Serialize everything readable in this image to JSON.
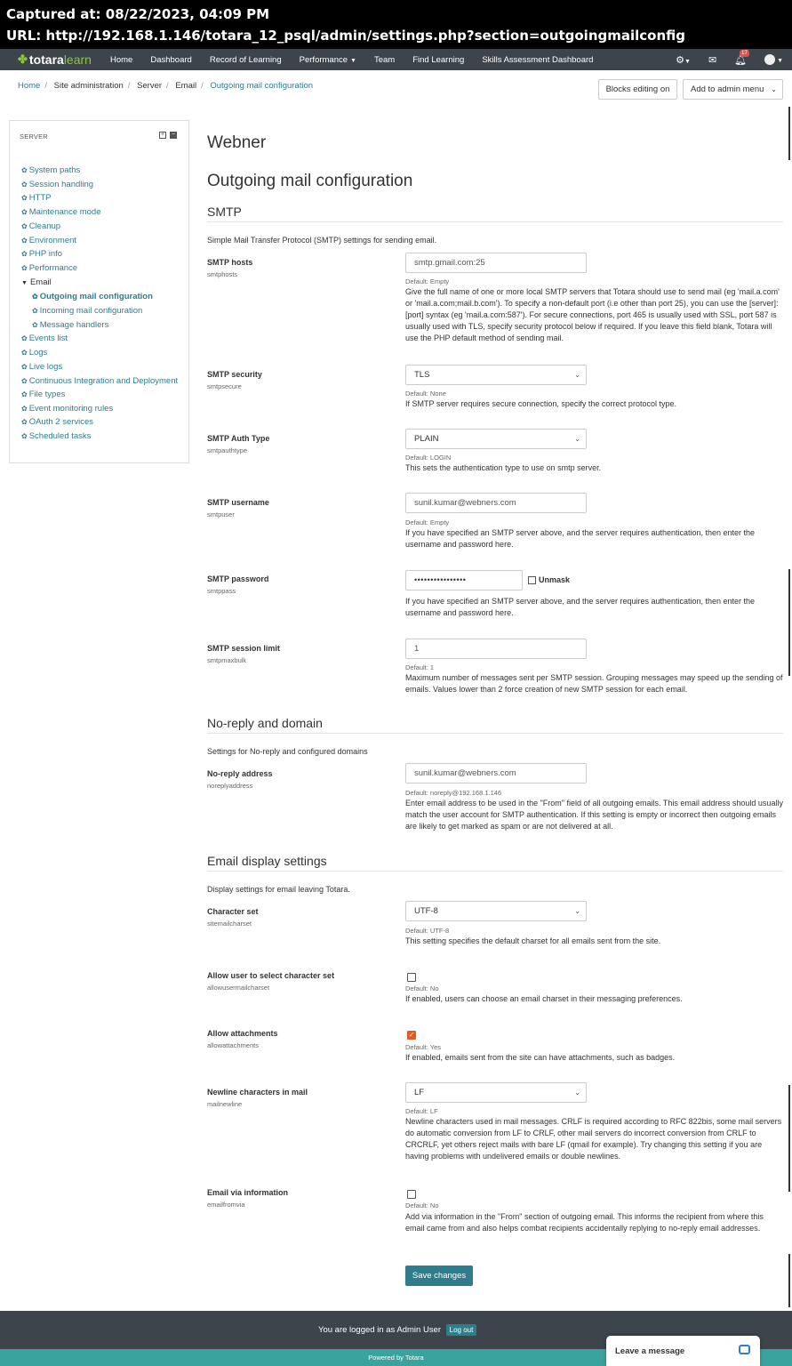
{
  "capture": {
    "captured_at": "Captured at: 08/22/2023, 04:09 PM",
    "url": "URL: http://192.168.1.146/totara_12_psql/admin/settings.php?section=outgoingmailconfig"
  },
  "navbar": {
    "logo_main": "totara",
    "logo_sub": "learn",
    "items": [
      "Home",
      "Dashboard",
      "Record of Learning",
      "Performance",
      "Team",
      "Find Learning",
      "Skills Assessment Dashboard"
    ],
    "notification_count": "17"
  },
  "breadcrumb": [
    "Home",
    "Site administration",
    "Server",
    "Email",
    "Outgoing mail configuration"
  ],
  "toolbar": {
    "blocks_editing": "Blocks editing on",
    "add_to_admin_menu": "Add to admin menu"
  },
  "sidebar": {
    "title": "SERVER",
    "items": [
      "System paths",
      "Session handling",
      "HTTP",
      "Maintenance mode",
      "Cleanup",
      "Environment",
      "PHP info",
      "Performance",
      "Email",
      "Outgoing mail configuration",
      "Incoming mail configuration",
      "Message handlers",
      "Events list",
      "Logs",
      "Live logs",
      "Continuous Integration and Deployment",
      "File types",
      "Event monitoring rules",
      "OAuth 2 services",
      "Scheduled tasks"
    ]
  },
  "main": {
    "site_name": "Webner",
    "page_title": "Outgoing mail configuration",
    "sections": {
      "smtp": {
        "title": "SMTP",
        "desc": "Simple Mail Transfer Protocol (SMTP) settings for sending email."
      },
      "noreply": {
        "title": "No-reply and domain",
        "desc": "Settings for No-reply and configured domains"
      },
      "display": {
        "title": "Email display settings",
        "desc": "Display settings for email leaving Totara."
      }
    },
    "settings": {
      "smtphosts": {
        "label": "SMTP hosts",
        "name": "smtphosts",
        "value": "smtp.gmail.com:25",
        "default": "Default: Empty",
        "desc": "Give the full name of one or more local SMTP servers that Totara should use to send mail (eg 'mail.a.com' or 'mail.a.com;mail.b.com'). To specify a non-default port (i.e other than port 25), you can use the [server]:[port] syntax (eg 'mail.a.com:587'). For secure connections, port 465 is usually used with SSL, port 587 is usually used with TLS, specify security protocol below if required. If you leave this field blank, Totara will use the PHP default method of sending mail."
      },
      "smtpsecure": {
        "label": "SMTP security",
        "name": "smtpsecure",
        "value": "TLS",
        "default": "Default: None",
        "desc": "If SMTP server requires secure connection, specify the correct protocol type."
      },
      "smtpauthtype": {
        "label": "SMTP Auth Type",
        "name": "smtpauthtype",
        "value": "PLAIN",
        "default": "Default: LOGIN",
        "desc": "This sets the authentication type to use on smtp server."
      },
      "smtpuser": {
        "label": "SMTP username",
        "name": "smtpuser",
        "value": "sunil.kumar@webners.com",
        "default": "Default: Empty",
        "desc": "If you have specified an SMTP server above, and the server requires authentication, then enter the username and password here."
      },
      "smtppass": {
        "label": "SMTP password",
        "name": "smtppass",
        "value": "••••••••••••••••",
        "unmask": "Unmask",
        "desc": "If you have specified an SMTP server above, and the server requires authentication, then enter the username and password here."
      },
      "smtpmaxbulk": {
        "label": "SMTP session limit",
        "name": "smtpmaxbulk",
        "value": "1",
        "default": "Default: 1",
        "desc": "Maximum number of messages sent per SMTP session. Grouping messages may speed up the sending of emails. Values lower than 2 force creation of new SMTP session for each email."
      },
      "noreplyaddress": {
        "label": "No-reply address",
        "name": "noreplyaddress",
        "value": "sunil.kumar@webners.com",
        "default": "Default: noreply@192.168.1.146",
        "desc": "Enter email address to be used in the \"From\" field of all outgoing emails. This email address should usually match the user account for SMTP authentication. If this setting is empty or incorrect then outgoing emails are likely to get marked as spam or are not delivered at all."
      },
      "sitemailcharset": {
        "label": "Character set",
        "name": "sitemailcharset",
        "value": "UTF-8",
        "default": "Default: UTF-8",
        "desc": "This setting specifies the default charset for all emails sent from the site."
      },
      "allowusermailcharset": {
        "label": "Allow user to select character set",
        "name": "allowusermailcharset",
        "default": "Default: No",
        "desc": "If enabled, users can choose an email charset in their messaging preferences."
      },
      "allowattachments": {
        "label": "Allow attachments",
        "name": "allowattachments",
        "default": "Default: Yes",
        "desc": "If enabled, emails sent from the site can have attachments, such as badges."
      },
      "mailnewline": {
        "label": "Newline characters in mail",
        "name": "mailnewline",
        "value": "LF",
        "default": "Default: LF",
        "desc": "Newline characters used in mail messages. CRLF is required according to RFC 822bis, some mail servers do automatic conversion from LF to CRLF, other mail servers do incorrect conversion from CRLF to CRCRLF, yet others reject mails with bare LF (qmail for example). Try changing this setting if you are having problems with undelivered emails or double newlines."
      },
      "emailfromvia": {
        "label": "Email via information",
        "name": "emailfromvia",
        "default": "Default: No",
        "desc": "Add via information in the \"From\" section of outgoing email. This informs the recipient from where this email came from and also helps combat recipients accidentally replying to no-reply email addresses."
      }
    },
    "save_label": "Save changes"
  },
  "footer": {
    "logged_in": "You are logged in as Admin User",
    "logout": "Log out",
    "powered": "Powered by Totara",
    "chat": "Leave a message"
  }
}
